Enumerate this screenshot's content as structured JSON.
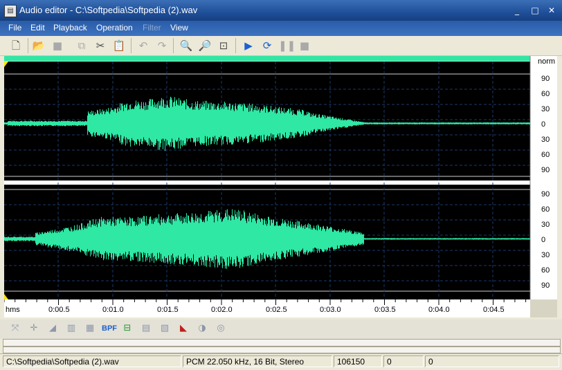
{
  "window": {
    "title": "Audio editor - C:\\Softpedia\\Softpedia (2).wav",
    "minimize": "_",
    "maximize": "□",
    "close": "✕"
  },
  "menu": [
    "File",
    "Edit",
    "Playback",
    "Operation",
    "Filter",
    "View"
  ],
  "toolbar_icons": [
    "new-file-icon",
    "open-folder-icon",
    "save-icon",
    "copy-icon",
    "cut-icon",
    "paste-icon",
    "undo-icon",
    "redo-icon",
    "zoom-in-icon",
    "zoom-out-icon",
    "zoom-fit-icon",
    "play-icon",
    "play-loop-icon",
    "pause-icon",
    "stop-icon"
  ],
  "waveform": {
    "norm_label": "norm",
    "channel1_scale": [
      "90",
      "60",
      "30",
      "0",
      "30",
      "60",
      "90"
    ],
    "channel2_scale": [
      "90",
      "60",
      "30",
      "0",
      "30",
      "60",
      "90"
    ],
    "time_unit": "hms",
    "time_ticks": [
      "0:00.5",
      "0:01.0",
      "0:01.5",
      "0:02.0",
      "0:02.5",
      "0:03.0",
      "0:03.5",
      "0:04.0",
      "0:04.5"
    ],
    "wave_color": "#2ee8a4",
    "background": "#000000"
  },
  "effects": {
    "bpf_label": "BPF"
  },
  "status": {
    "file": "C:\\Softpedia\\Softpedia (2).wav",
    "format": "PCM 22.050 kHz, 16 Bit, Stereo",
    "samples": "106150",
    "sel_start": "0",
    "sel_len": "0"
  }
}
